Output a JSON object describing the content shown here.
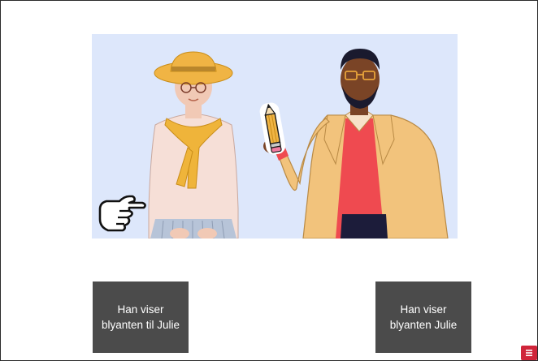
{
  "answers": [
    {
      "label": "Han viser\nblyanten til Julie"
    },
    {
      "label": "Han viser\nblyanten Julie"
    }
  ],
  "illustration": {
    "background_color": "#dde7fb",
    "pointing_hand_icon": "pointing-hand-icon",
    "pencil_icon": "pencil-icon"
  },
  "menu_button": {
    "icon": "menu-icon",
    "color": "#d0253a"
  }
}
